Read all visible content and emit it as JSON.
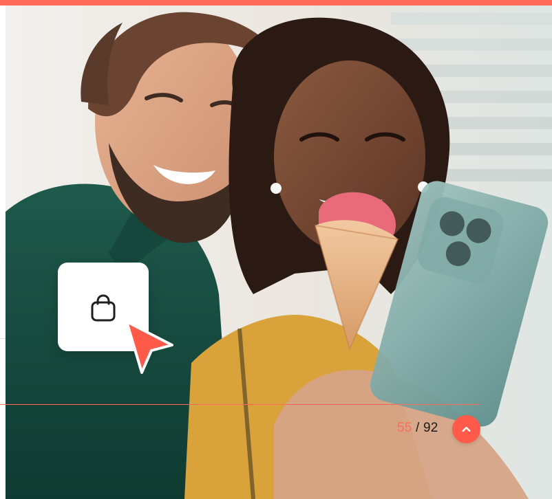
{
  "colors": {
    "accent": "#ff6b5b",
    "button": "#ff5a4a",
    "text": "#1b1b1b"
  },
  "hero": {
    "image": "photo-couple-selfie-ice-cream",
    "card_icon": "shopping-bag-icon",
    "cursor_icon": "cursor-arrow-icon"
  },
  "pagination": {
    "current": "55",
    "separator": " / ",
    "total": "92"
  },
  "scroll_top": {
    "icon": "chevron-up-icon"
  }
}
